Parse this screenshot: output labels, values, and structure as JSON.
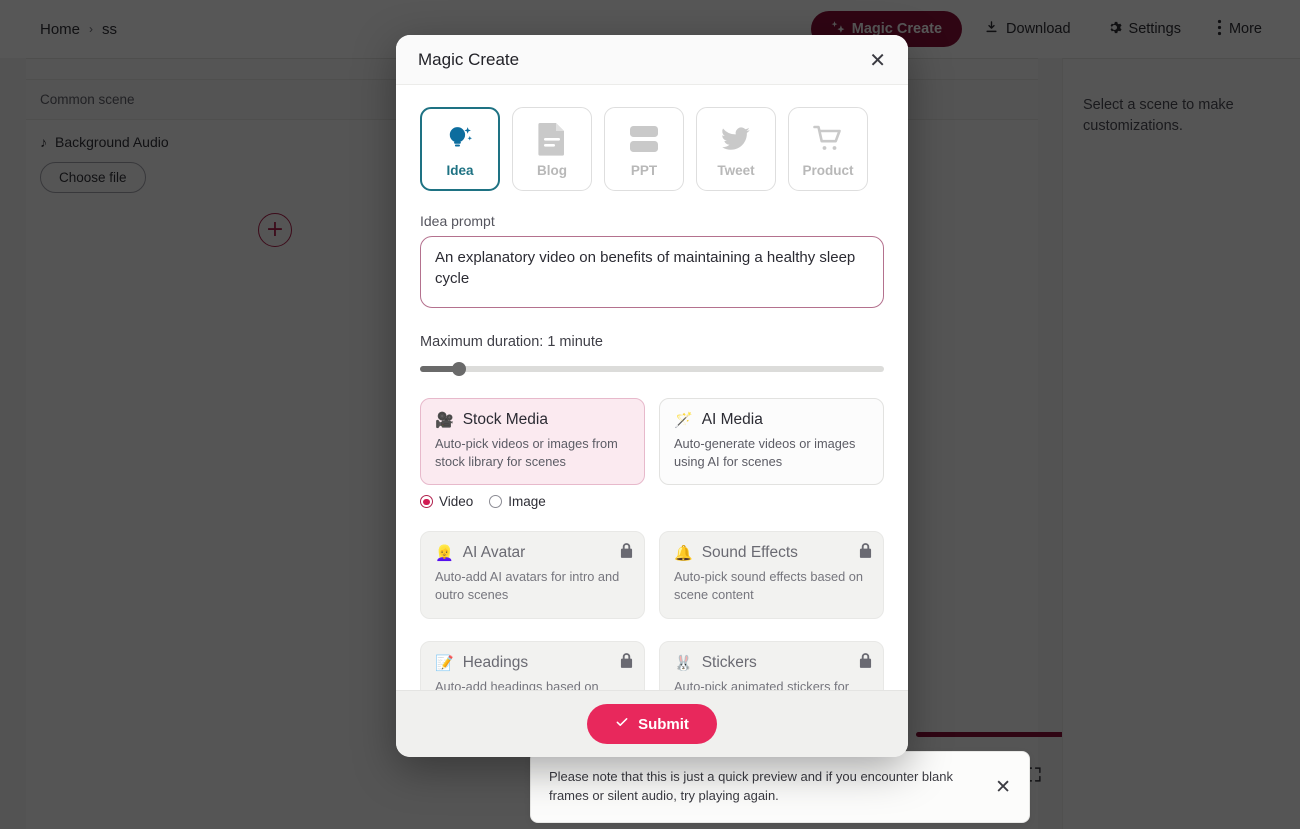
{
  "topbar": {
    "breadcrumb": {
      "home": "Home",
      "separator": "›",
      "current": "ss"
    },
    "magic_create_label": "Magic Create",
    "magic_create_icon": "sparkles-icon",
    "magic_create_color": "#8a1038",
    "actions": [
      {
        "label": "Download",
        "icon": "download-icon"
      },
      {
        "label": "Settings",
        "icon": "gear-icon"
      },
      {
        "label": "More",
        "icon": "dots-vertical-icon"
      }
    ]
  },
  "left_panel": {
    "scene_header": "Common scene",
    "background_audio_label": "Background Audio",
    "background_audio_icon": "music-note-icon",
    "choose_file_label": "Choose file",
    "add_scene_icon": "plus-circle-icon",
    "player": {
      "progress_percent": 100,
      "progress_color": "#8a1038",
      "share_icon": "share-icon",
      "fullscreen_icon": "fullscreen-icon"
    }
  },
  "right_panel": {
    "empty_text": "Select a scene to make customizations."
  },
  "toast": {
    "message": "Please note that this is just a quick preview and if you encounter blank frames or silent audio, try playing again.",
    "close_icon": "close-icon"
  },
  "modal": {
    "title": "Magic Create",
    "close_icon": "close-icon",
    "type_tabs": [
      {
        "label": "Idea",
        "icon": "lightbulb-sparkle-icon",
        "active": true
      },
      {
        "label": "Blog",
        "icon": "document-icon",
        "active": false
      },
      {
        "label": "PPT",
        "icon": "slides-icon",
        "active": false
      },
      {
        "label": "Tweet",
        "icon": "twitter-bird-icon",
        "active": false
      },
      {
        "label": "Product",
        "icon": "shopping-cart-icon",
        "active": false
      }
    ],
    "prompt": {
      "label": "Idea prompt",
      "value": "An explanatory video on benefits of maintaining a healthy sleep cycle",
      "placeholder": "Idea prompt"
    },
    "duration": {
      "label": "Maximum duration: 1 minute",
      "value": "1 minute",
      "slider_percent": 7
    },
    "media_options": [
      {
        "title": "Stock Media",
        "emoji": "🎥",
        "icon": "movie-camera-icon",
        "description": "Auto-pick videos or images from stock library for scenes",
        "selected": true,
        "locked": false
      },
      {
        "title": "AI Media",
        "emoji": "🪄",
        "icon": "magic-wand-icon",
        "description": "Auto-generate videos or images using AI for scenes",
        "selected": false,
        "locked": false
      }
    ],
    "media_format": {
      "options": [
        {
          "label": "Video",
          "selected": true
        },
        {
          "label": "Image",
          "selected": false
        }
      ]
    },
    "feature_options": [
      {
        "title": "AI Avatar",
        "emoji": "👱‍♀️",
        "icon": "avatar-icon",
        "description": "Auto-add AI avatars for intro and outro scenes",
        "locked": true
      },
      {
        "title": "Sound Effects",
        "emoji": "🔔",
        "icon": "bell-icon",
        "description": "Auto-pick sound effects based on scene content",
        "locked": true
      },
      {
        "title": "Headings",
        "emoji": "📝",
        "icon": "memo-icon",
        "description": "Auto-add headings based on scene content",
        "locked": true
      },
      {
        "title": "Stickers",
        "emoji": "🐰",
        "icon": "rabbit-icon",
        "description": "Auto-pick animated stickers for scenes",
        "locked": true
      }
    ],
    "submit": {
      "label": "Submit",
      "icon": "check-icon",
      "color": "#e8285c"
    }
  }
}
